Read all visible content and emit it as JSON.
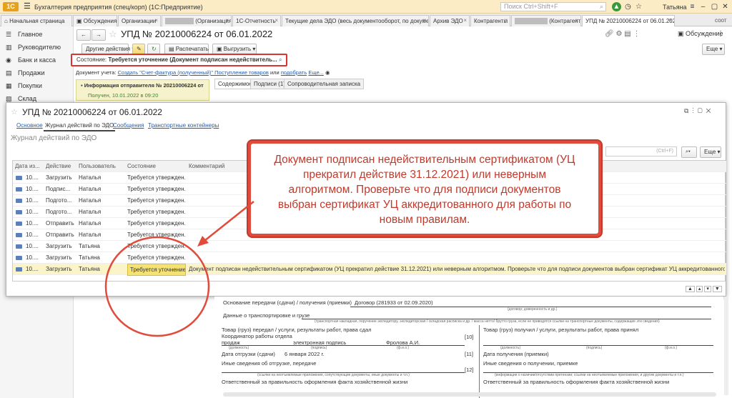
{
  "titlebar": {
    "logo": "1С",
    "app_title": "Бухгалтерия предприятия (спец/корп)  (1С:Предприятие)",
    "search_placeholder": "Поиск Ctrl+Shift+F",
    "user": "Татьяна"
  },
  "tabs": [
    {
      "label": "Начальная страница"
    },
    {
      "label": "Обсуждения"
    },
    {
      "label": "Организации"
    },
    {
      "label": "(Организация)"
    },
    {
      "label": "1С-Отчетность"
    },
    {
      "label": "Текущие дела ЭДО (весь документооборот, по документам)"
    },
    {
      "label": "Архив ЭДО"
    },
    {
      "label": "Контрагенты"
    },
    {
      "label": "(Контрагент)"
    },
    {
      "label": "УПД № 20210006224 от 06.01.2022"
    }
  ],
  "tabs_extra": "соот",
  "sidebar": {
    "items": [
      {
        "label": "Главное",
        "icon": "menu-icon"
      },
      {
        "label": "Руководителю",
        "icon": "chart-icon"
      },
      {
        "label": "Банк и касса",
        "icon": "bank-icon"
      },
      {
        "label": "Продажи",
        "icon": "cart-icon"
      },
      {
        "label": "Покупки",
        "icon": "basket-icon"
      },
      {
        "label": "Склад",
        "icon": "warehouse-icon"
      }
    ]
  },
  "document": {
    "title": "УПД № 20210006224 от 06.01.2022",
    "buttons": {
      "other_actions": "Другие действия",
      "print": "Распечатать",
      "export": "Выгрузить",
      "discussion": "Обсуждение",
      "more": "Еще"
    },
    "status_label": "Состояние:",
    "status_value": "Требуется уточнение (Документ подписан недействитель...",
    "accounting_label": "Документ учета:",
    "accounting_link": "Создать \"Счет-фактура (полученный)\" Поступление товаров",
    "accounting_or": "или",
    "accounting_pick": "подобрать",
    "accounting_more": "Еще...",
    "sender_info": "Информация отправителя № 20210006224 от",
    "received": "Получен, 10.01.2022 в 09:20",
    "inner_tabs": [
      "Содержимое",
      "Подписи (1)",
      "Сопроводительная записка"
    ]
  },
  "modal": {
    "title": "УПД № 20210006224 от 06.01.2022",
    "tabs": [
      "Основное",
      "Журнал действий по ЭДО",
      "Сообщения",
      "Транспортные контейнеры"
    ],
    "section_title": "Журнал действий по ЭДО",
    "search_hint": "(Ctrl+F)",
    "more": "Еще",
    "columns": [
      "Дата из...",
      "Действие",
      "Пользователь",
      "Состояние",
      "Комментарий"
    ],
    "rows": [
      {
        "date": "10....",
        "action": "Загрузить",
        "user": "Наталья",
        "state": "Требуется утвержден...",
        "comment": ""
      },
      {
        "date": "10....",
        "action": "Подпис...",
        "user": "Наталья",
        "state": "Требуется утвержден...",
        "comment": ""
      },
      {
        "date": "10....",
        "action": "Подгото...",
        "user": "Наталья",
        "state": "Требуется утвержден...",
        "comment": ""
      },
      {
        "date": "10....",
        "action": "Подгото...",
        "user": "Наталья",
        "state": "Требуется утвержден...",
        "comment": ""
      },
      {
        "date": "10....",
        "action": "Отправить",
        "user": "Наталья",
        "state": "Требуется утвержден...",
        "comment": ""
      },
      {
        "date": "10....",
        "action": "Отправить",
        "user": "Наталья",
        "state": "Требуется утвержден...",
        "comment": ""
      },
      {
        "date": "10....",
        "action": "Загрузить",
        "user": "Татьяна",
        "state": "Требуется утвержден...",
        "comment": ""
      },
      {
        "date": "10....",
        "action": "Загрузить",
        "user": "Татьяна",
        "state": "Требуется утвержден...",
        "comment": ""
      },
      {
        "date": "10....",
        "action": "Загрузить",
        "user": "Татьяна",
        "state": "Требуется уточнение",
        "comment": "Документ подписан недействительным  сертификатом (УЦ прекратил действие 31.12.2021) или неверным алгоритмом. Проверьте что для подписи документов выбран сертификат УЦ аккредитованного для работы по новым правилам."
      }
    ]
  },
  "callout": {
    "lines": [
      "Документ подписан недействительным  сертификатом (УЦ",
      "прекратил действие 31.12.2021) или неверным",
      "алгоритмом. Проверьте что для подписи документов",
      "выбран сертификат УЦ аккредитованного для работы по",
      "новым правилам."
    ],
    "color": "#e04b3c"
  },
  "form": {
    "basis_label": "Основание передачи (сдачи) / получения (приемки)",
    "basis_value": "Договор (281933 от 02.09.2020)",
    "basis_hint": "(договор; доверенность и др.)",
    "transport_label": "Данные о транспортировке и грузе",
    "transport_hint": "(транспортная накладная, поручение экспедитору, экспедиторская / складская расписка и др. / масса нетто/ брутто груза, если не приводятся ссылки на транспортные документы, содержащие эти сведения)",
    "left": {
      "transferred": "Товар (груз) передал / услуги, результаты работ, права сдал",
      "coordinator": "Координатор работы отдела",
      "sales": "продаж",
      "signature": "электронная подпись",
      "person": "Фролова А.И.",
      "num10": "[10]",
      "pos": "(должность)",
      "sig": "(подпись)",
      "fio": "(ф.и.о.)",
      "ship_date_label": "Дата отгрузки (сдачи)",
      "ship_date": "6 января 2022 г.",
      "num11": "[11]",
      "other_label": "Иные сведения об отгрузке, передаче",
      "num12": "[12]",
      "other_hint": "(ссылки на неотъемлемые приложения, сопутствующие документы, иные документы и т.п.)",
      "responsible": "Ответственный за правильность оформления факта хозяйственной жизни"
    },
    "right": {
      "received": "Товар (груз) получил / услуги, результаты работ, права принял",
      "pos": "(должность)",
      "sig": "(подпись)",
      "fio": "(ф.и.о.)",
      "receive_date_label": "Дата получения (приемки)",
      "other_label": "Иные сведения о получении, приемке",
      "other_hint": "(информация о наличии/отсутствии претензии; ссылки на неотъемлемые приложения, и другие документы и т.п.)",
      "responsible": "Ответственный за правильность оформления факта хозяйственной жизни"
    }
  }
}
